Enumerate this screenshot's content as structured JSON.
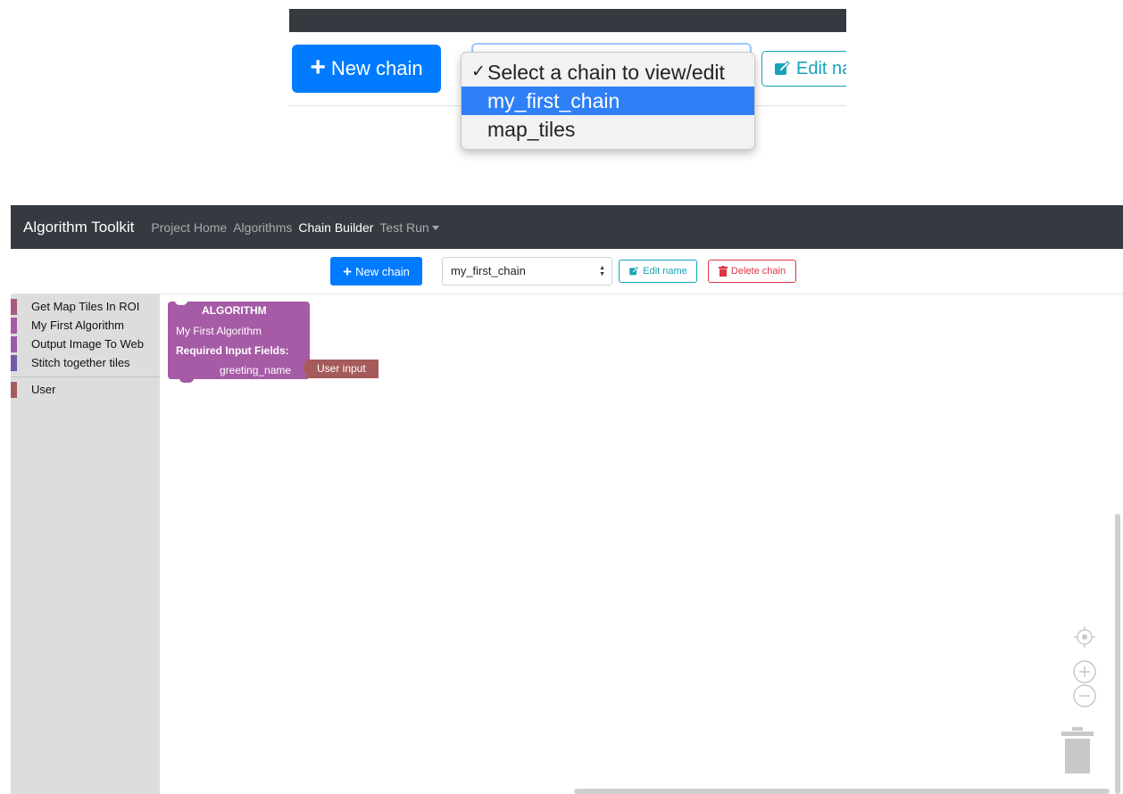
{
  "inset": {
    "new_chain": "New chain",
    "edit_name": "Edit na",
    "options": [
      {
        "label": "Select a chain to view/edit",
        "checked": true,
        "highlighted": false
      },
      {
        "label": "my_first_chain",
        "checked": false,
        "highlighted": true
      },
      {
        "label": "map_tiles",
        "checked": false,
        "highlighted": false
      }
    ]
  },
  "navbar": {
    "brand": "Algorithm Toolkit",
    "links": [
      {
        "label": "Project Home",
        "active": false
      },
      {
        "label": "Algorithms",
        "active": false
      },
      {
        "label": "Chain Builder",
        "active": true
      },
      {
        "label": "Test Run",
        "active": false,
        "dropdown": true
      }
    ]
  },
  "toolbar": {
    "new_chain": "New chain",
    "selected_chain": "my_first_chain",
    "edit_name": "Edit name",
    "delete_chain": "Delete chain"
  },
  "sidebar": {
    "categories": [
      {
        "label": "Get Map Tiles In ROI",
        "color": "#a55b80"
      },
      {
        "label": "My First Algorithm",
        "color": "#a55ba5"
      },
      {
        "label": "Output Image To Web",
        "color": "#995ba5"
      },
      {
        "label": "Stitch together tiles",
        "color": "#745ba5"
      },
      {
        "label": "User",
        "color": "#a55b5b"
      }
    ]
  },
  "workspace": {
    "block": {
      "type_label": "ALGORITHM",
      "name": "My First Algorithm",
      "required_label": "Required Input Fields:",
      "field": "greeting_name",
      "color": "#a55ba5"
    },
    "input_block": {
      "label": "User input",
      "color": "#a55b5b"
    }
  },
  "colors": {
    "primary": "#007bff",
    "info": "#17a2b8",
    "danger": "#dc3545",
    "navbar": "#343a40"
  }
}
